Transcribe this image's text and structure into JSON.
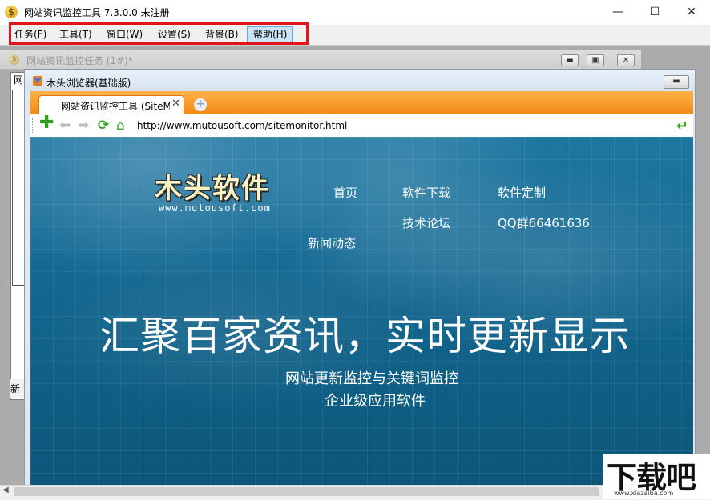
{
  "app": {
    "title": "网站资讯监控工具 7.3.0.0  未注册",
    "window_controls": {
      "minimize": "—",
      "maximize": "☐",
      "close": "✕"
    }
  },
  "menubar": {
    "items": [
      {
        "label": "任务(F)"
      },
      {
        "label": "工具(T)"
      },
      {
        "label": "窗口(W)"
      },
      {
        "label": "设置(S)"
      },
      {
        "label": "背景(B)"
      },
      {
        "label": "帮助(H)"
      }
    ],
    "highlight_color": "#e0151b"
  },
  "mdi": {
    "title": "网站资讯监控任务  (1#)*",
    "left_text": "网",
    "status_text": "新"
  },
  "browser": {
    "title": "木头浏览器(基础版)",
    "tab_label": "网站资讯监控工具 (SiteM",
    "url": "http://www.mutousoft.com/sitemonitor.html",
    "tab_accent": "#f08a14"
  },
  "webpage": {
    "logo": "木头软件",
    "logo_url": "www.mutousoft.com",
    "nav": {
      "home": "首页",
      "download": "软件下载",
      "custom": "软件定制",
      "forum": "技术论坛",
      "qq": "QQ群66461636",
      "news": "新闻动态"
    },
    "headline": "汇聚百家资讯，实时更新显示",
    "subtitle1": "网站更新监控与关键词监控",
    "subtitle2": "企业级应用软件"
  },
  "watermark": {
    "logo": "下载吧",
    "url": "www.xiazaiba.com"
  }
}
